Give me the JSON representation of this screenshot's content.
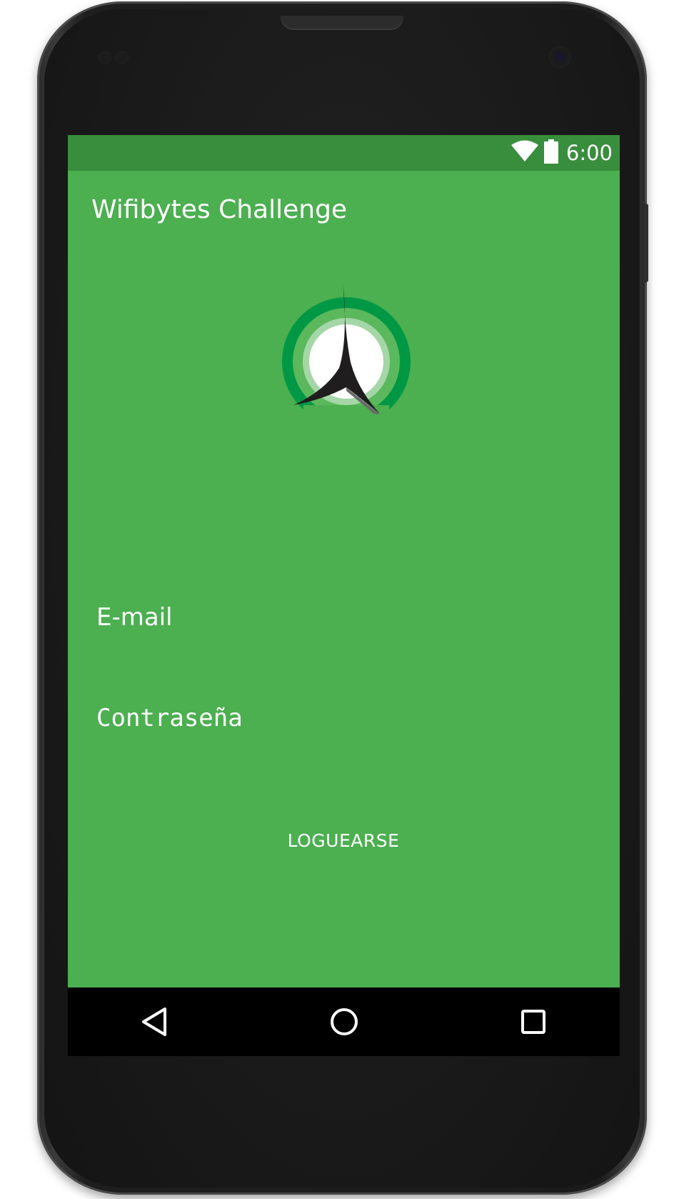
{
  "status_bar": {
    "time": "6:00",
    "wifi_icon": "wifi-icon",
    "battery_icon": "battery-icon"
  },
  "app_bar": {
    "title": "Wifibytes Challenge"
  },
  "logo": {
    "icon": "wifibytes-logo",
    "colors": {
      "outer_ring": "#009845",
      "middle_ring": "#5cb85c",
      "inner_ring": "#a5d6a7",
      "center": "#ffffff",
      "peak": "#1f1d1d"
    }
  },
  "form": {
    "email_placeholder": "E-mail",
    "password_placeholder": "Contraseña",
    "login_label": "LOGUEARSE"
  },
  "nav_bar": {
    "back_icon": "back-triangle-icon",
    "home_icon": "home-circle-icon",
    "recents_icon": "recents-square-icon"
  },
  "colors": {
    "primary": "#4caf50",
    "primary_dark": "#388e3c",
    "nav_background": "#000000",
    "text": "#ffffff"
  }
}
